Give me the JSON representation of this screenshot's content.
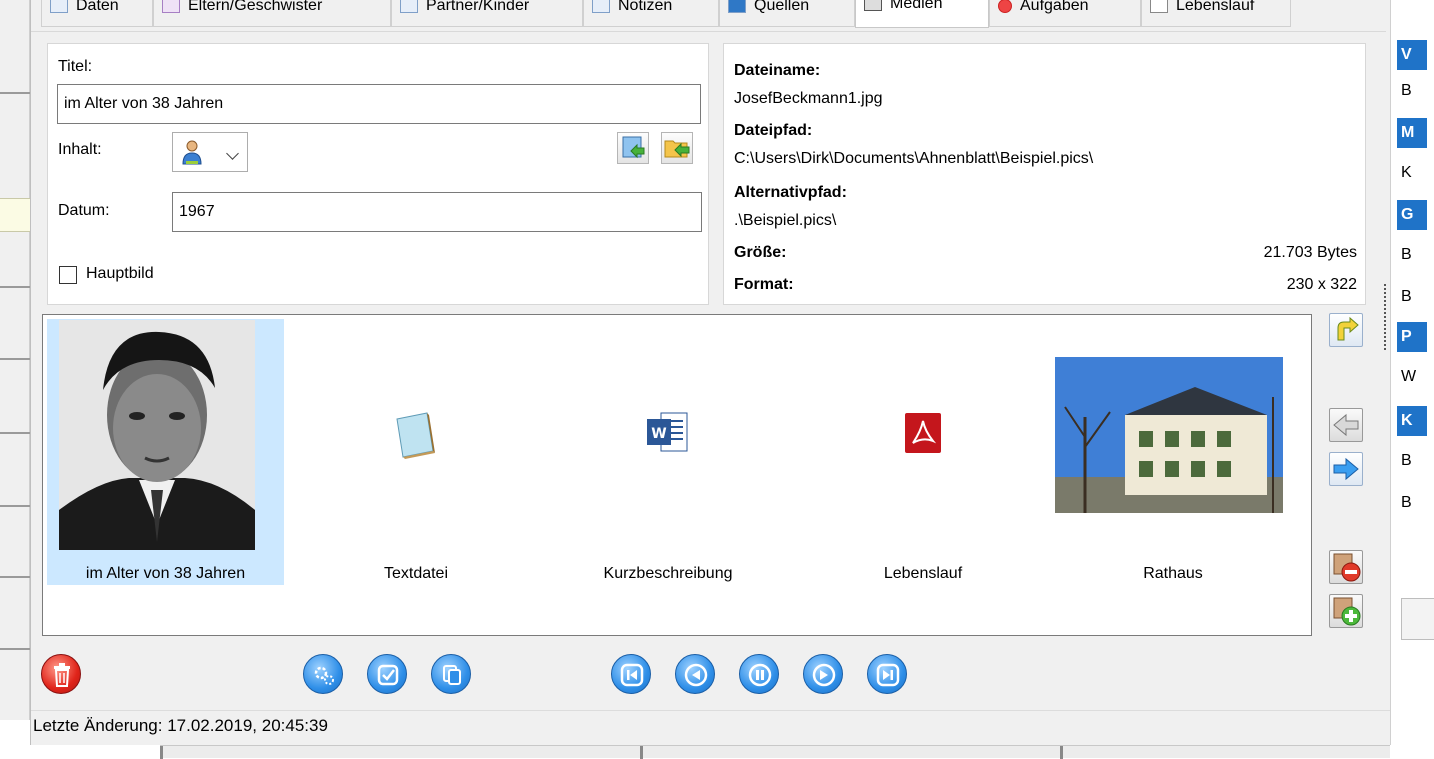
{
  "tabs": [
    "Daten",
    "Eltern/Geschwister",
    "Partner/Kinder",
    "Notizen",
    "Quellen",
    "Medien",
    "Aufgaben",
    "Lebenslauf"
  ],
  "form": {
    "title_label": "Titel:",
    "title_value": "im Alter von 38 Jahren",
    "content_label": "Inhalt:",
    "date_label": "Datum:",
    "date_value": "1967",
    "main_image_label": "Hauptbild"
  },
  "file_info": {
    "filename_label": "Dateiname:",
    "filename": "JosefBeckmann1.jpg",
    "filepath_label": "Dateipfad:",
    "filepath": "C:\\Users\\Dirk\\Documents\\Ahnenblatt\\Beispiel.pics\\",
    "altpath_label": "Alternativpfad:",
    "altpath": ".\\Beispiel.pics\\",
    "size_label": "Größe:",
    "size": "21.703 Bytes",
    "format_label": "Format:",
    "format": "230 x 322"
  },
  "gallery": [
    {
      "caption": "im Alter von 38 Jahren",
      "icon": "portrait-photo"
    },
    {
      "caption": "Textdatei",
      "icon": "notepad-icon"
    },
    {
      "caption": "Kurzbeschreibung",
      "icon": "word-icon"
    },
    {
      "caption": "Lebenslauf",
      "icon": "pdf-icon"
    },
    {
      "caption": "Rathaus",
      "icon": "building-photo"
    }
  ],
  "status": {
    "last_change": "Letzte Änderung: 17.02.2019, 20:45:39"
  },
  "right_panel": {
    "items": [
      {
        "text": "V",
        "type": "header"
      },
      {
        "text": "B",
        "type": "row"
      },
      {
        "text": "M",
        "type": "header"
      },
      {
        "text": "K",
        "type": "row"
      },
      {
        "text": "G",
        "type": "header"
      },
      {
        "text": "B",
        "type": "row"
      },
      {
        "text": "B",
        "type": "row"
      },
      {
        "text": "P",
        "type": "header"
      },
      {
        "text": "W",
        "type": "row"
      },
      {
        "text": "K",
        "type": "header"
      },
      {
        "text": "B",
        "type": "row"
      },
      {
        "text": "B",
        "type": "row"
      }
    ]
  }
}
